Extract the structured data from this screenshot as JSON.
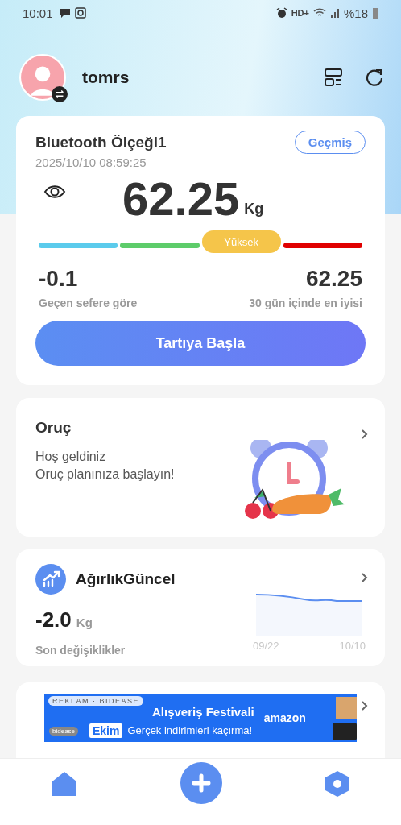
{
  "status_bar": {
    "time": "10:01",
    "network": "HD+",
    "battery": "%18"
  },
  "header": {
    "username": "tomrs"
  },
  "scale_card": {
    "title": "Bluetooth Ölçeği1",
    "history_button": "Geçmiş",
    "timestamp": "2025/10/10 08:59:25",
    "weight": "62.25",
    "unit": "Kg",
    "segments": [
      {
        "color": "#5bcbec",
        "selected": false
      },
      {
        "color": "#5dcc6a",
        "selected": false
      },
      {
        "color": "#f5c54a",
        "selected": true,
        "label": "Yüksek"
      },
      {
        "color": "#e00000",
        "selected": false
      }
    ],
    "change": "-0.1",
    "change_label": "Geçen sefere göre",
    "best": "62.25",
    "best_label": "30 gün içinde en iyisi",
    "start_button": "Tartıya Başla"
  },
  "fasting_card": {
    "title": "Oruç",
    "lines": [
      "Hoş geldiniz",
      "Oruç planınıza başlayın!"
    ]
  },
  "trend_card": {
    "title": "AğırlıkGüncel",
    "value": "-2.0",
    "unit": "Kg",
    "caption": "Son değişiklikler",
    "x_start": "09/22",
    "x_end": "10/10"
  },
  "ad_banner": {
    "tag": "REKLAM · BIDEASE",
    "headline": "Alışveriş Festivali",
    "date": "Ekim",
    "slogan": "Gerçek indirimleri kaçırma!",
    "brand": "amazon",
    "badge": "bidease"
  },
  "bottom_nav": [
    {
      "kind": "home"
    },
    {
      "kind": "add"
    },
    {
      "kind": "settings"
    }
  ]
}
